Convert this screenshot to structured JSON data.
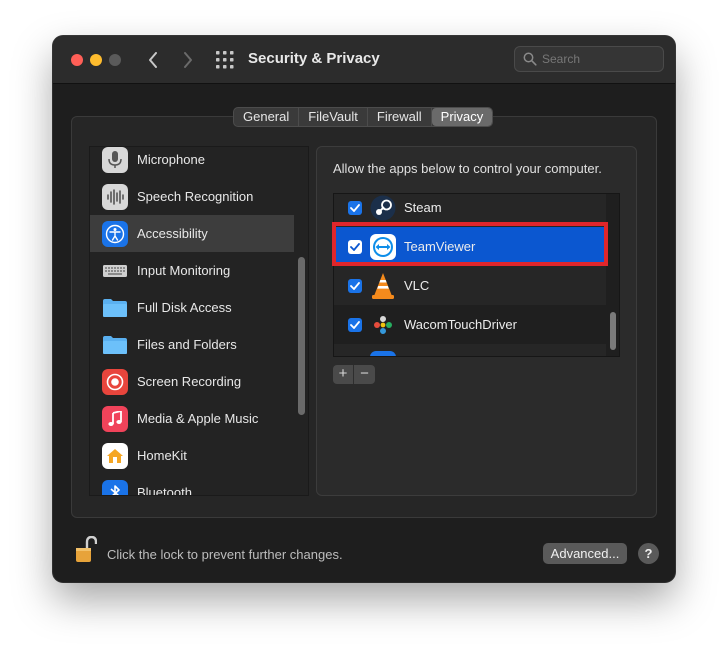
{
  "window": {
    "title": "Security & Privacy"
  },
  "search": {
    "placeholder": "Search"
  },
  "tabs": [
    {
      "label": "General"
    },
    {
      "label": "FileVault"
    },
    {
      "label": "Firewall"
    },
    {
      "label": "Privacy",
      "active": true
    }
  ],
  "sidebar": {
    "items": [
      {
        "label": "Microphone",
        "icon": "microphone-icon"
      },
      {
        "label": "Speech Recognition",
        "icon": "waveform-icon"
      },
      {
        "label": "Accessibility",
        "icon": "accessibility-icon",
        "selected": true
      },
      {
        "label": "Input Monitoring",
        "icon": "keyboard-icon"
      },
      {
        "label": "Full Disk Access",
        "icon": "folder-icon"
      },
      {
        "label": "Files and Folders",
        "icon": "folder-icon"
      },
      {
        "label": "Screen Recording",
        "icon": "record-icon"
      },
      {
        "label": "Media & Apple Music",
        "icon": "music-note-icon"
      },
      {
        "label": "HomeKit",
        "icon": "home-icon"
      },
      {
        "label": "Bluetooth",
        "icon": "bluetooth-icon"
      }
    ]
  },
  "right_pane": {
    "heading": "Allow the apps below to control your computer.",
    "apps": [
      {
        "label": "Steam",
        "checked": true,
        "icon": "steam-icon"
      },
      {
        "label": "TeamViewer",
        "checked": true,
        "icon": "teamviewer-icon",
        "selected": true
      },
      {
        "label": "VLC",
        "checked": true,
        "icon": "vlc-cone-icon"
      },
      {
        "label": "WacomTouchDriver",
        "checked": true,
        "icon": "wacom-icon"
      }
    ],
    "add_label": "+",
    "remove_label": "−"
  },
  "footer": {
    "lock_text": "Click the lock to prevent further changes.",
    "advanced_label": "Advanced...",
    "help_label": "?"
  },
  "colors": {
    "accent": "#0b57d0",
    "checkbox": "#1a73e8",
    "highlight_border": "#e0262b"
  }
}
